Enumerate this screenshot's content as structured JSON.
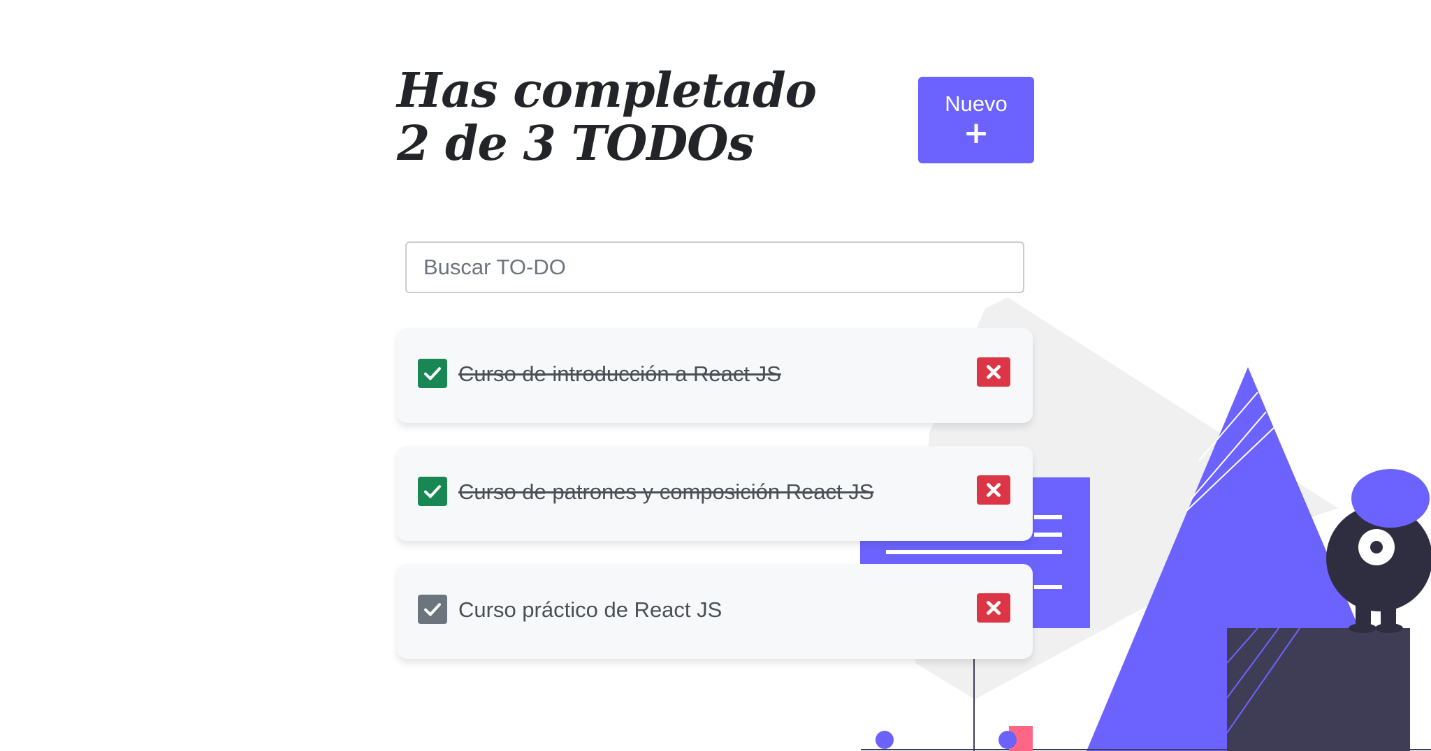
{
  "header": {
    "title": "Has completado 2 de 3 TODOs"
  },
  "new_button": {
    "label": "Nuevo",
    "icon": "plus-icon"
  },
  "search": {
    "placeholder": "Buscar TO-DO",
    "value": ""
  },
  "todos": [
    {
      "text": "Curso de introducción a React JS",
      "completed": true
    },
    {
      "text": "Curso de patrones y composición React JS",
      "completed": true
    },
    {
      "text": "Curso práctico de React JS",
      "completed": false
    }
  ],
  "icons": {
    "check": "check-icon",
    "delete": "close-icon"
  },
  "colors": {
    "accent": "#6c63ff",
    "completed_check": "#198754",
    "pending_check": "#6c757d",
    "delete": "#dc3545",
    "title": "#222428",
    "card_background": "#f7f8f9",
    "illustration_dark": "#3f3d56"
  }
}
